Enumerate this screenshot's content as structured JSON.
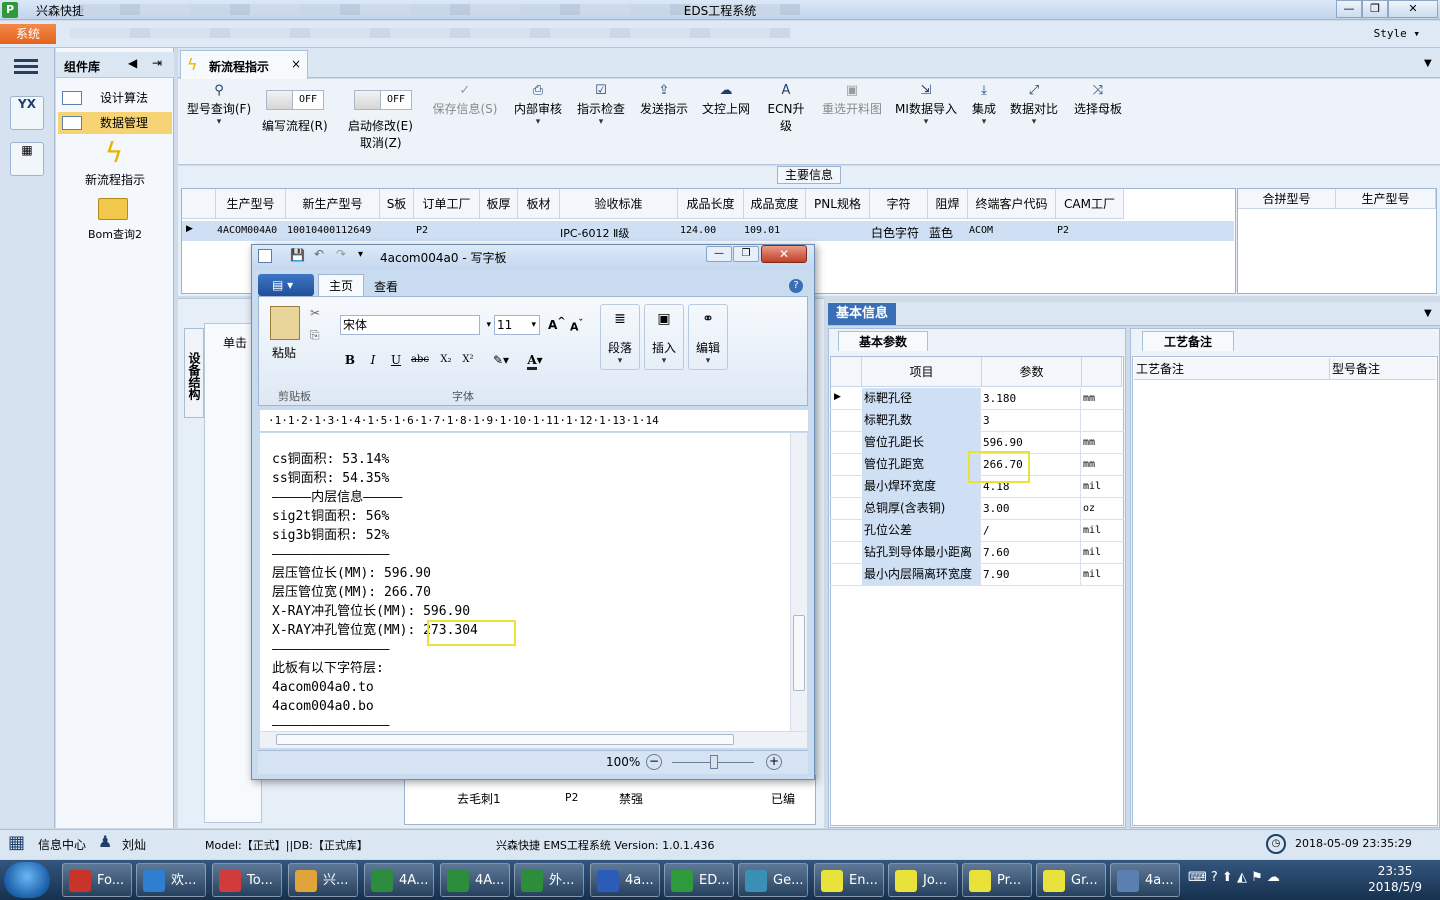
{
  "titlebar": {
    "app_name": "兴森快捷",
    "window_title": "EDS工程系统",
    "min": "—",
    "max": "❐",
    "close": "✕"
  },
  "menubar": {
    "system_tab": "系统",
    "style_label": "Style"
  },
  "component_panel": {
    "title": "组件库",
    "items": [
      "设计算法",
      "数据管理"
    ],
    "launchers": [
      "新流程指示",
      "Bom查询2"
    ]
  },
  "tab": {
    "label": "新流程指示",
    "close": "×"
  },
  "toolbar": {
    "model_query": "型号查询(F)",
    "edit_flow": "编写流程(R)",
    "edit_flow_toggle": "OFF",
    "enable_edit": "启动修改(E)",
    "enable_edit_sub": "取消(Z)",
    "enable_edit_toggle": "OFF",
    "save_info": "保存信息(S)",
    "internal_review": "内部审核",
    "check_instructions": "指示检查",
    "send_instructions": "发送指示",
    "upload_doc": "文控上网",
    "ecn_upgrade": "ECN升级",
    "reselect_material": "重选开料图",
    "mi_import": "MI数据导入",
    "integrate": "集成",
    "compare": "数据对比",
    "select_mother": "选择母板"
  },
  "main_info": {
    "caption": "主要信息",
    "columns": [
      "生产型号",
      "新生产型号",
      "S板",
      "订单工厂",
      "板厚",
      "板材",
      "验收标准",
      "成品长度",
      "成品宽度",
      "PNL规格",
      "字符",
      "阻焊",
      "终端客户代码",
      "CAM工厂"
    ],
    "row": [
      "4ACOM004A0",
      "10010400112649",
      "P2",
      "",
      "",
      "",
      "IPC-6012 Ⅱ级",
      "124.00",
      "109.01",
      "",
      "白色字符",
      "蓝色",
      "ACOM",
      "P2"
    ],
    "side_columns": [
      "合拼型号",
      "生产型号"
    ]
  },
  "left_lower": {
    "vertical_tab": "设备结构",
    "panel_label": "单击",
    "bottom_row": {
      "name": "去毛刺1",
      "code": "P2",
      "status": "禁强",
      "tail": "已编"
    }
  },
  "basic_info": {
    "tab": "基本信息",
    "params_tab": "基本参数",
    "columns": [
      "项目",
      "参数"
    ],
    "rows": [
      {
        "name": "标靶孔径",
        "value": "3.180",
        "unit": "mm"
      },
      {
        "name": "标靶孔数",
        "value": "3",
        "unit": ""
      },
      {
        "name": "管位孔距长",
        "value": "596.90",
        "unit": "mm"
      },
      {
        "name": "管位孔距宽",
        "value": "266.70",
        "unit": "mm"
      },
      {
        "name": "最小焊环宽度",
        "value": "4.18",
        "unit": "mil"
      },
      {
        "name": "总铜厚(含表铜)",
        "value": "3.00",
        "unit": "oz"
      },
      {
        "name": "孔位公差",
        "value": "/",
        "unit": "mil"
      },
      {
        "name": "钻孔到导体最小距离",
        "value": "7.60",
        "unit": "mil"
      },
      {
        "name": "最小内层隔离环宽度",
        "value": "7.90",
        "unit": "mil"
      }
    ],
    "craft_tab": "工艺备注",
    "craft_columns": [
      "工艺备注",
      "型号备注"
    ]
  },
  "wordpad": {
    "title": "4acom004a0 - 写字板",
    "tab_home": "主页",
    "tab_view": "查看",
    "paste": "粘贴",
    "clipboard": "剪贴板",
    "font_name": "宋体",
    "font_size": "11",
    "font_group": "字体",
    "paragraph": "段落",
    "insert": "插入",
    "edit": "编辑",
    "ruler": "·1·1·2·1·3·1·4·1·5·1·6·1·7·1·8·1·9·1·10·1·11·1·12·1·13·1·14",
    "lines": [
      "cs铜面积: 53.14%",
      "ss铜面积: 54.35%",
      "—————内层信息—————",
      "sig2t铜面积: 56%",
      "sig3b铜面积: 52%",
      "———————————————",
      "层压管位长(MM): 596.90",
      "层压管位宽(MM): 266.70",
      "X-RAY冲孔管位长(MM): 596.90",
      "X-RAY冲孔管位宽(MM): 273.304",
      "———————————————",
      "此板有以下字符层:",
      "4acom004a0.to",
      "4acom004a0.bo",
      "———————————————"
    ],
    "zoom": "100%"
  },
  "statusbar": {
    "info_center": "信息中心",
    "user": "刘灿",
    "model": "Model:【正式】||DB:【正式库】",
    "version": "兴森快捷 EMS工程系统 Version: 1.0.1.436",
    "datetime": "2018-05-09 23:35:29"
  },
  "taskbar": {
    "items": [
      "Fo...",
      "欢...",
      "To...",
      "兴...",
      "4A...",
      "4A...",
      "外...",
      "4a...",
      "ED...",
      "Ge...",
      "En...",
      "Jo...",
      "Pr...",
      "Gr...",
      "4a..."
    ],
    "time": "23:35",
    "date": "2018/5/9"
  },
  "colors": {
    "accent": "#3a6fb5",
    "highlight_box": "#e8e23a",
    "selected_row": "#cfe0f5"
  }
}
